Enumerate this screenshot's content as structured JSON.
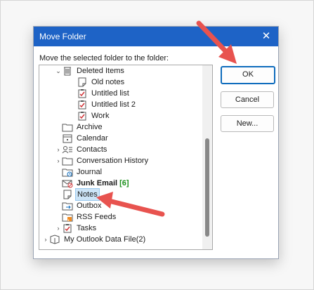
{
  "dialog": {
    "title": "Move Folder",
    "prompt": "Move the selected folder to the folder:",
    "buttons": {
      "ok": "OK",
      "cancel": "Cancel",
      "new": "New..."
    }
  },
  "tree": {
    "deleted_items": "Deleted Items",
    "old_notes": "Old notes",
    "untitled_list": "Untitled list",
    "untitled_list_2": "Untitled list 2",
    "work": "Work",
    "archive": "Archive",
    "calendar": "Calendar",
    "contacts": "Contacts",
    "conversation_history": "Conversation History",
    "journal": "Journal",
    "junk_email": "Junk Email",
    "junk_count": "[6]",
    "notes": "Notes",
    "outbox": "Outbox",
    "rss_feeds": "RSS Feeds",
    "tasks": "Tasks",
    "data_file": "My Outlook Data File(2)"
  },
  "colors": {
    "titlebar": "#1e63c6",
    "selection": "#cce4f7",
    "arrow": "#e8534f",
    "count": "#1a8f1a"
  }
}
